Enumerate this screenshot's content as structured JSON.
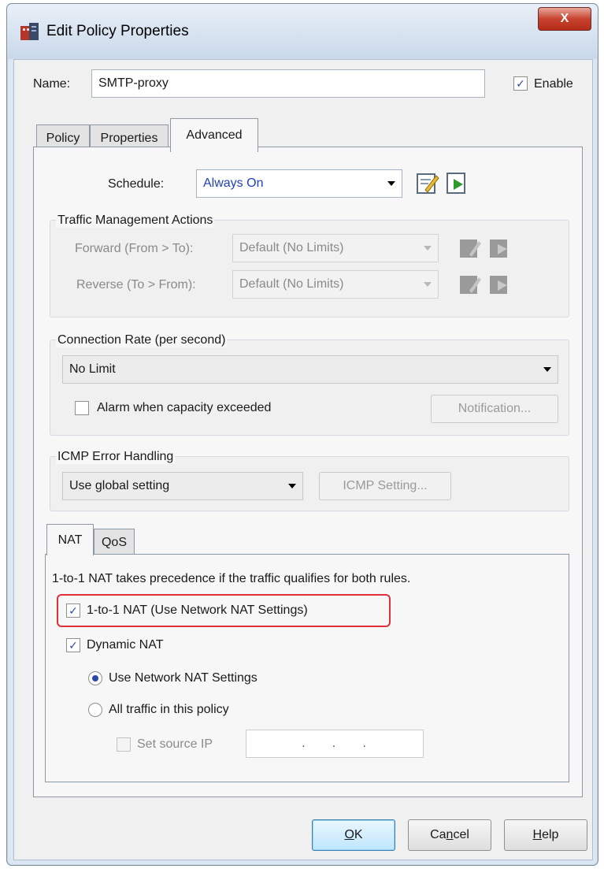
{
  "window": {
    "title": "Edit Policy Properties",
    "close_label": "X"
  },
  "name_row": {
    "label": "Name:",
    "value": "SMTP-proxy",
    "enable_label": "Enable",
    "enable_checked": true
  },
  "tabs": [
    {
      "label": "Policy",
      "active": false
    },
    {
      "label": "Properties",
      "active": false
    },
    {
      "label": "Advanced",
      "active": true
    }
  ],
  "schedule": {
    "label": "Schedule:",
    "value": "Always On"
  },
  "traffic_management": {
    "title": "Traffic Management Actions",
    "forward_label": "Forward (From > To):",
    "forward_value": "Default (No Limits)",
    "reverse_label": "Reverse (To > From):",
    "reverse_value": "Default (No Limits)"
  },
  "connection_rate": {
    "title": "Connection Rate (per second)",
    "value": "No Limit",
    "alarm_label": "Alarm when capacity exceeded",
    "alarm_checked": false,
    "notification_label": "Notification..."
  },
  "icmp": {
    "title": "ICMP Error Handling",
    "value": "Use global setting",
    "setting_button": "ICMP Setting..."
  },
  "inner_tabs": [
    {
      "label": "NAT",
      "active": true
    },
    {
      "label": "QoS",
      "active": false
    }
  ],
  "nat": {
    "note": "1-to-1 NAT takes precedence if the traffic qualifies for both rules.",
    "one_to_one_label": "1-to-1 NAT (Use Network NAT Settings)",
    "one_to_one_checked": true,
    "dynamic_label": "Dynamic NAT",
    "dynamic_checked": true,
    "radio_network_label": "Use Network NAT Settings",
    "radio_all_label": "All traffic in this policy",
    "radio_selected": "network",
    "source_ip_label": "Set source IP",
    "source_ip_value": ".     .     ."
  },
  "footer": {
    "ok_prefix": "",
    "ok_ul": "O",
    "ok_rest": "K",
    "cancel_prefix": "Ca",
    "cancel_ul": "n",
    "cancel_rest": "cel",
    "help_prefix": "",
    "help_ul": "H",
    "help_rest": "elp"
  },
  "colors": {
    "highlight": "#e0313a",
    "schedule_value": "#2041b8"
  },
  "icons": {
    "app": "firewall-policy-icon",
    "edit": "edit-icon",
    "add": "add-icon"
  }
}
